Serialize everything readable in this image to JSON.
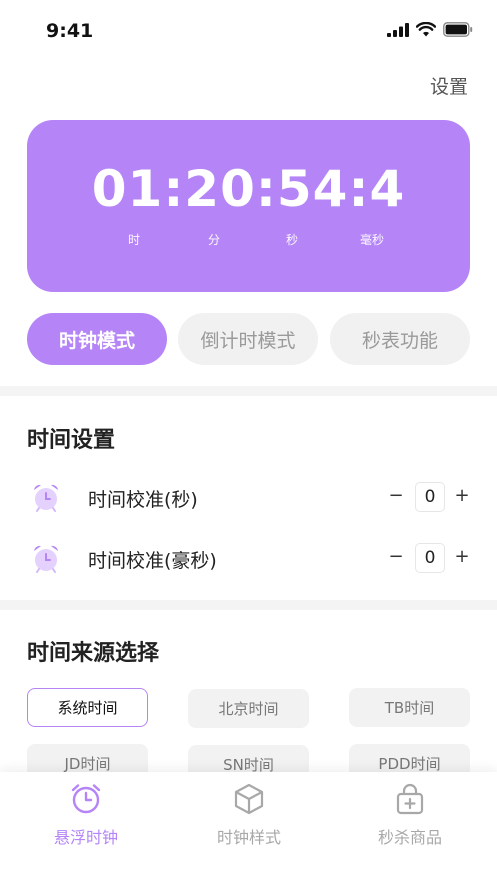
{
  "status": {
    "time": "9:41"
  },
  "header": {
    "settings_label": "设置"
  },
  "clock": {
    "display": "01:20:54:4",
    "units": {
      "hour": "时",
      "minute": "分",
      "second": "秒",
      "millisecond": "毫秒"
    }
  },
  "modes": [
    {
      "label": "时钟模式",
      "active": true
    },
    {
      "label": "倒计时模式",
      "active": false
    },
    {
      "label": "秒表功能",
      "active": false
    }
  ],
  "time_settings": {
    "title": "时间设置",
    "rows": [
      {
        "label": "时间校准(秒)",
        "minus": "−",
        "value": "0",
        "plus": "+"
      },
      {
        "label": "时间校准(豪秒)",
        "minus": "−",
        "value": "0",
        "plus": "+"
      }
    ]
  },
  "time_source": {
    "title": "时间来源选择",
    "options": [
      {
        "label": "系统时间",
        "selected": true
      },
      {
        "label": "北京时间",
        "selected": false
      },
      {
        "label": "TB时间",
        "selected": false
      },
      {
        "label": "JD时间",
        "selected": false
      },
      {
        "label": "SN时间",
        "selected": false
      },
      {
        "label": "PDD时间",
        "selected": false
      }
    ]
  },
  "tabbar": {
    "items": [
      {
        "label": "悬浮时钟",
        "icon": "alarm-clock-icon",
        "active": true
      },
      {
        "label": "时钟样式",
        "icon": "cube-icon",
        "active": false
      },
      {
        "label": "秒杀商品",
        "icon": "bag-plus-icon",
        "active": false
      }
    ]
  },
  "colors": {
    "accent": "#b585f7",
    "inactive_bg": "#f1f1f1",
    "inactive_text": "#a8a8a8"
  }
}
